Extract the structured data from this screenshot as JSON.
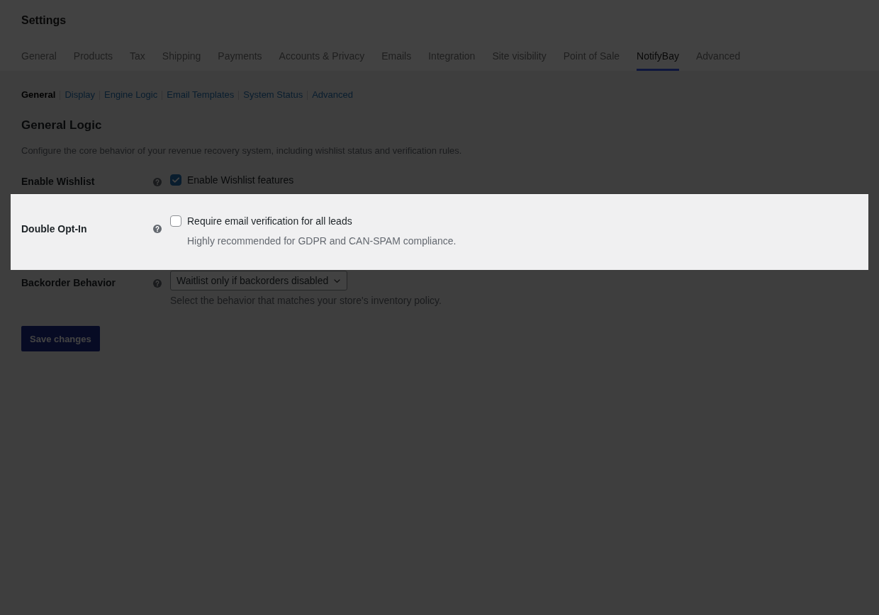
{
  "header": {
    "title": "Settings"
  },
  "tabs": [
    {
      "label": "General",
      "selected": false
    },
    {
      "label": "Products",
      "selected": false
    },
    {
      "label": "Tax",
      "selected": false
    },
    {
      "label": "Shipping",
      "selected": false
    },
    {
      "label": "Payments",
      "selected": false
    },
    {
      "label": "Accounts & Privacy",
      "selected": false
    },
    {
      "label": "Emails",
      "selected": false
    },
    {
      "label": "Integration",
      "selected": false
    },
    {
      "label": "Site visibility",
      "selected": false
    },
    {
      "label": "Point of Sale",
      "selected": false
    },
    {
      "label": "NotifyBay",
      "selected": true
    },
    {
      "label": "Advanced",
      "selected": false
    }
  ],
  "subnav": [
    {
      "label": "General",
      "selected": true
    },
    {
      "label": "Display",
      "selected": false
    },
    {
      "label": "Engine Logic",
      "selected": false
    },
    {
      "label": "Email Templates",
      "selected": false
    },
    {
      "label": "System Status",
      "selected": false
    },
    {
      "label": "Advanced",
      "selected": false
    }
  ],
  "section": {
    "title": "General Logic",
    "description": "Configure the core behavior of your revenue recovery system, including wishlist status and verification rules."
  },
  "fields": [
    {
      "kind": "checkbox",
      "label": "Enable Wishlist",
      "highlighted": false,
      "checked": true,
      "option": "Enable Wishlist features"
    },
    {
      "kind": "checkbox",
      "label": "Double Opt-In",
      "highlighted": true,
      "checked": false,
      "option": "Require email verification for all leads",
      "description": "Highly recommended for GDPR and CAN-SPAM compliance."
    },
    {
      "kind": "select",
      "label": "Backorder Behavior",
      "highlighted": false,
      "value": "Waitlist only if backorders disabled",
      "description": "Select the behavior that matches your store's inventory policy."
    }
  ],
  "save_button": {
    "label": "Save changes",
    "disabled": true
  }
}
